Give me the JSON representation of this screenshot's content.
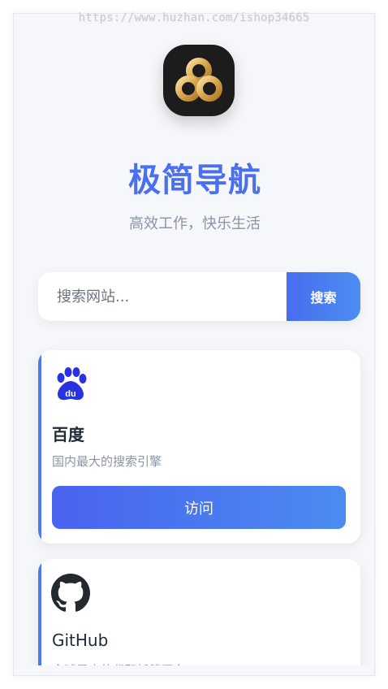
{
  "watermark": "https://www.huzhan.com/ishop34665",
  "header": {
    "title": "极简导航",
    "subtitle": "高效工作，快乐生活"
  },
  "search": {
    "placeholder": "搜索网站...",
    "button_label": "搜索"
  },
  "cards": [
    {
      "name": "百度",
      "description": "国内最大的搜索引擎",
      "button_label": "访问",
      "icon": "baidu-paw-icon"
    },
    {
      "name": "GitHub",
      "description": "全球最大的代码托管平台",
      "icon": "github-octocat-icon"
    }
  ],
  "colors": {
    "accent": "#4a6ff0",
    "background": "#f5f7fa",
    "muted_text": "#8a94a6"
  }
}
